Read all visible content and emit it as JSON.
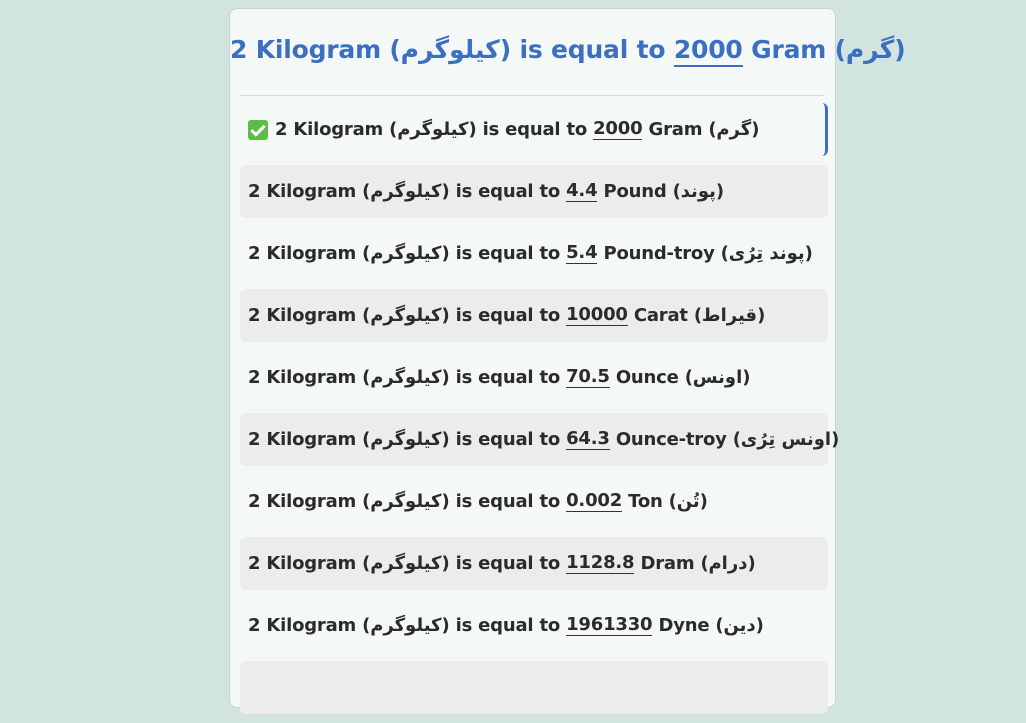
{
  "colors": {
    "page_bg": "#d2e4df",
    "title": "#3a6fc1",
    "row_shade": "#ececec",
    "check": "#5dbb4a"
  },
  "title": {
    "prefix": "2 Kilogram (کیلوگرم) is equal to",
    "value": "2000",
    "suffix": "Gram (گرم)"
  },
  "conversions": [
    {
      "prefix": "2 Kilogram (کیلوگرم) is equal to",
      "value": "2000",
      "suffix": "Gram (گرم)",
      "icon": "check-icon"
    },
    {
      "prefix": "2 Kilogram (کیلوگرم) is equal to",
      "value": "4.4",
      "suffix": "Pound (پوند)"
    },
    {
      "prefix": "2 Kilogram (کیلوگرم) is equal to",
      "value": "5.4",
      "suffix": "Pound-troy (پوند تِرُی)"
    },
    {
      "prefix": "2 Kilogram (کیلوگرم) is equal to",
      "value": "10000",
      "suffix": "Carat (قیراط)"
    },
    {
      "prefix": "2 Kilogram (کیلوگرم) is equal to",
      "value": "70.5",
      "suffix": "Ounce (اونس)"
    },
    {
      "prefix": "2 Kilogram (کیلوگرم) is equal to",
      "value": "64.3",
      "suffix": "Ounce-troy (اونس تِرُی)"
    },
    {
      "prefix": "2 Kilogram (کیلوگرم) is equal to",
      "value": "0.002",
      "suffix": "Ton (تُن)"
    },
    {
      "prefix": "2 Kilogram (کیلوگرم) is equal to",
      "value": "1128.8",
      "suffix": "Dram (درام)"
    },
    {
      "prefix": "2 Kilogram (کیلوگرم) is equal to",
      "value": "1961330",
      "suffix": "Dyne (دین)"
    },
    {
      "prefix": "",
      "value": "",
      "suffix": ""
    }
  ]
}
